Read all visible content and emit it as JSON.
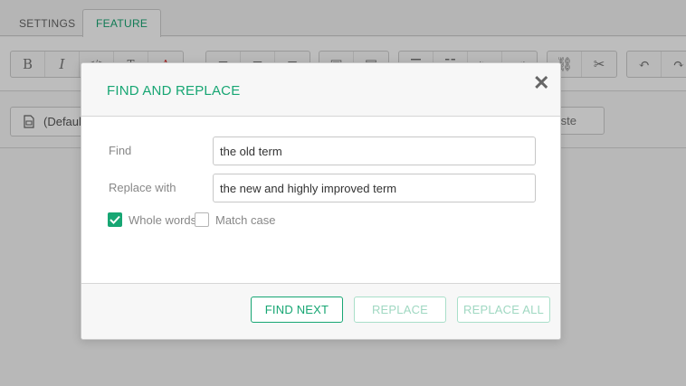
{
  "tabs": [
    {
      "label": "SETTINGS"
    },
    {
      "label": "FEATURE"
    }
  ],
  "toolbar": {
    "groups": [
      {
        "icons": [
          "bold-icon",
          "italic-icon",
          "code-icon",
          "text-icon",
          "font-color-icon"
        ]
      },
      {
        "icons": [
          "align-left-icon",
          "align-center-icon",
          "align-right-icon"
        ]
      },
      {
        "icons": [
          "image-icon",
          "media-icon"
        ]
      },
      {
        "icons": [
          "bullet-list-icon",
          "numbered-list-icon",
          "outdent-icon",
          "indent-icon"
        ]
      },
      {
        "icons": [
          "link-icon",
          "unlink-icon"
        ]
      },
      {
        "icons": [
          "undo-icon",
          "redo-icon"
        ]
      }
    ],
    "bold_glyph": "B",
    "italic_glyph": "I"
  },
  "format_select": {
    "value": "(Default)"
  },
  "paste_button": {
    "label": "Paste"
  },
  "dialog": {
    "title": "FIND AND REPLACE",
    "close_glyph": "✕",
    "find": {
      "label": "Find",
      "value": "the old term"
    },
    "replace": {
      "label": "Replace with",
      "value": "the new and highly improved term"
    },
    "options": {
      "whole_words": {
        "label": "Whole words",
        "checked": true
      },
      "match_case": {
        "label": "Match case",
        "checked": false
      }
    },
    "buttons": {
      "find_next": "FIND NEXT",
      "replace": "REPLACE",
      "replace_all": "REPLACE ALL"
    }
  },
  "colors": {
    "accent": "#17a673",
    "accent_disabled": "#a0d8c2"
  }
}
